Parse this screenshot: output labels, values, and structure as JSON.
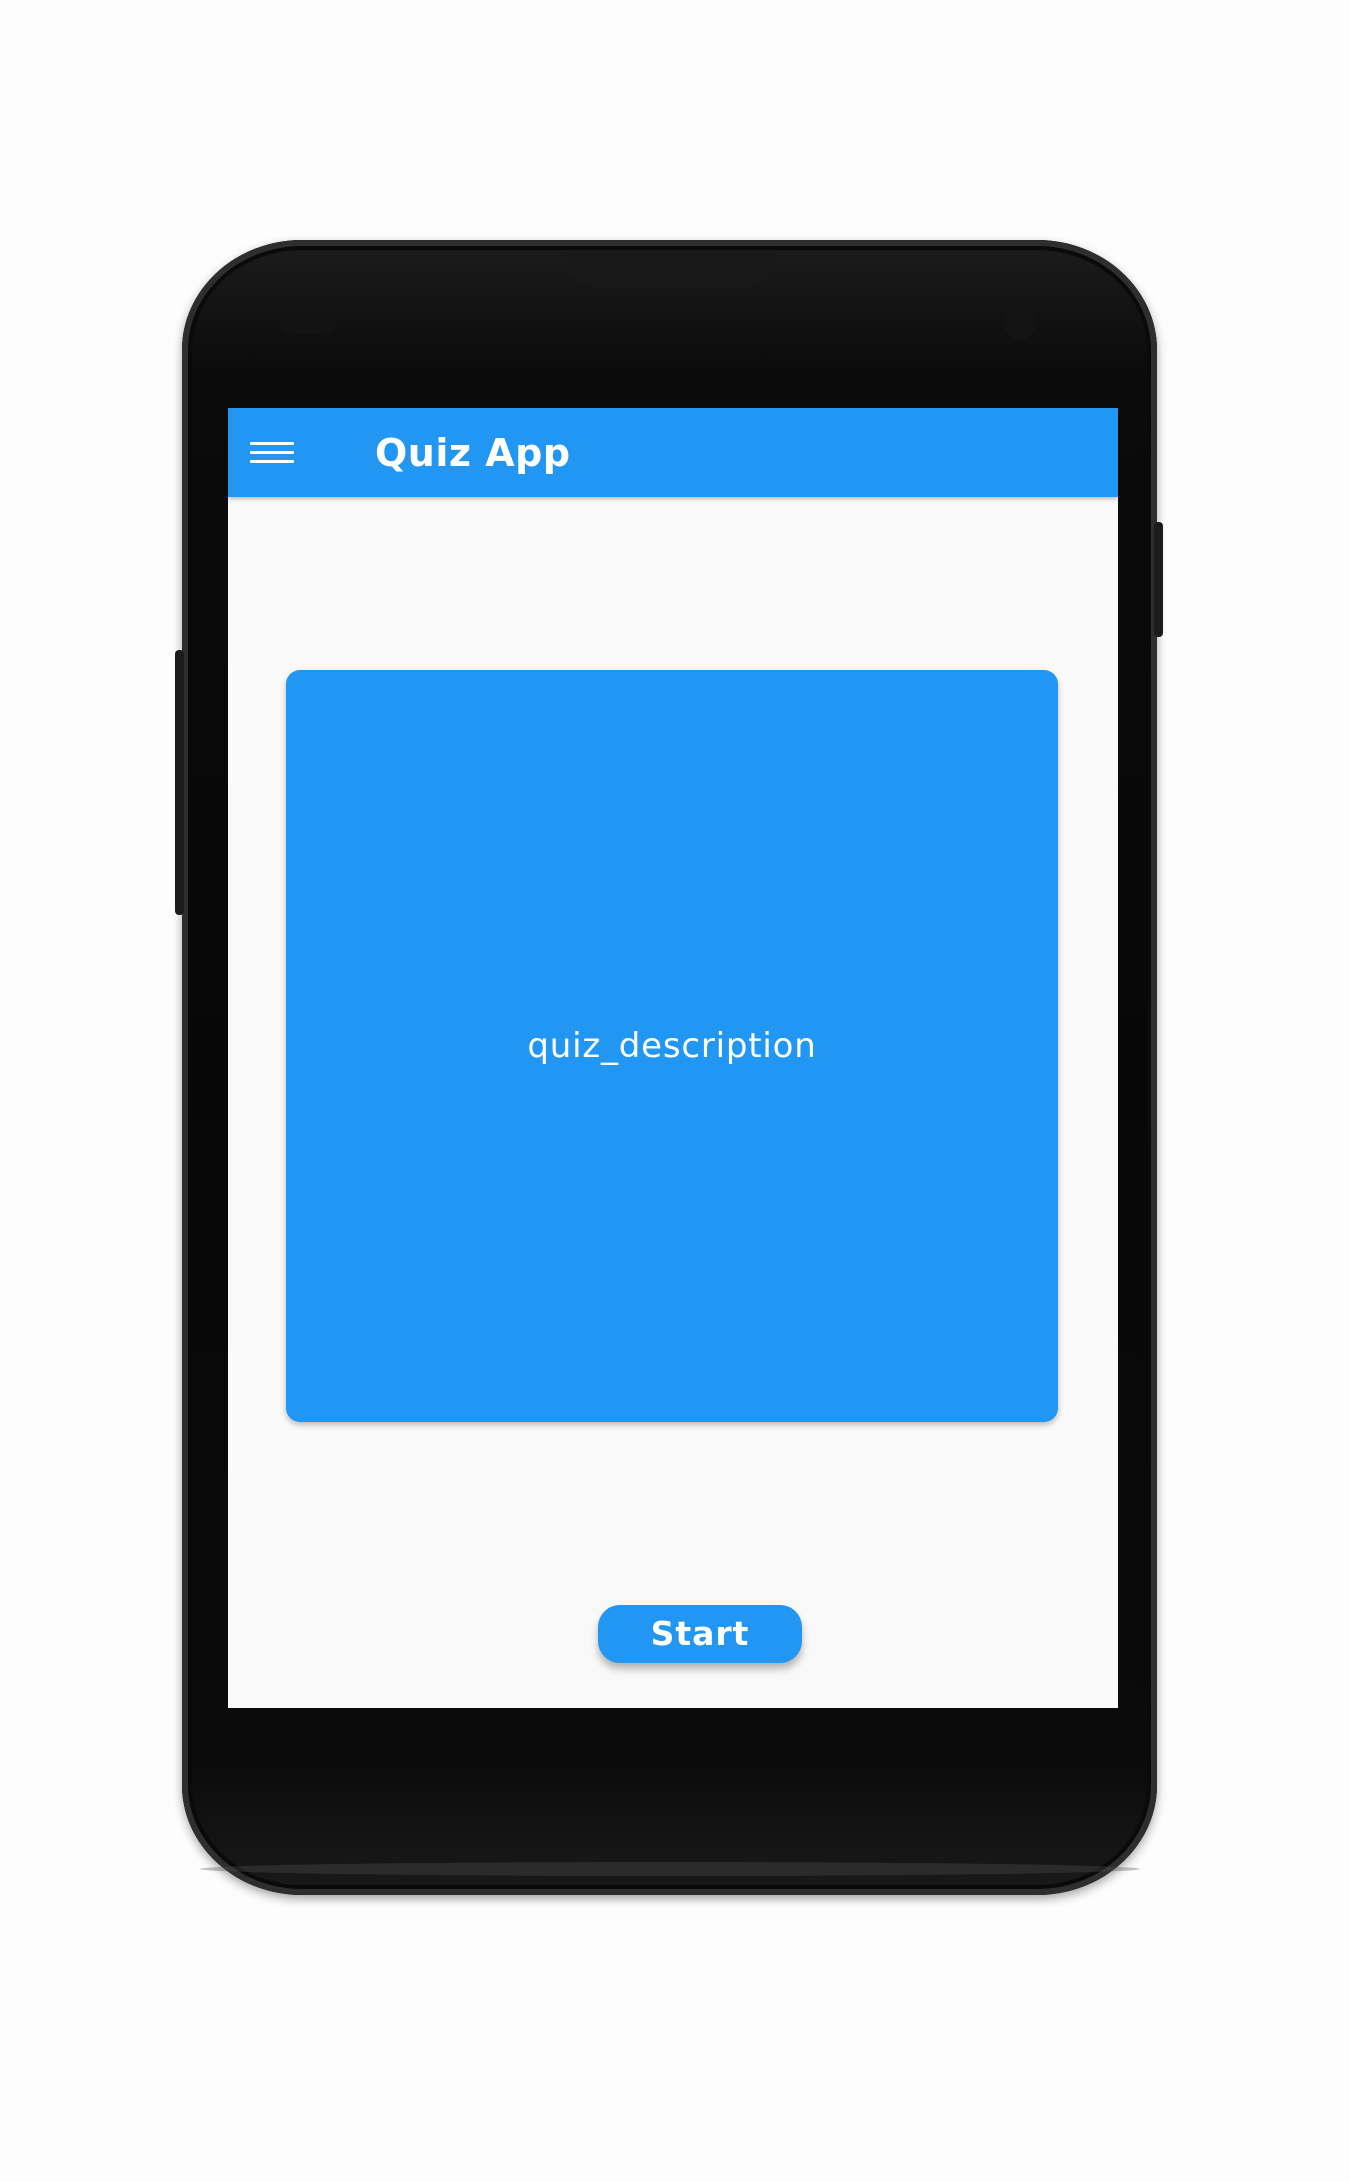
{
  "appbar": {
    "title": "Quiz App",
    "menu_icon": "hamburger-menu-icon",
    "color": "#2196f3"
  },
  "main": {
    "card_text": "quiz_description",
    "start_label": "Start"
  },
  "colors": {
    "accent": "#2196f3",
    "background": "#f9f9f9",
    "text_on_accent": "#ffffff"
  }
}
